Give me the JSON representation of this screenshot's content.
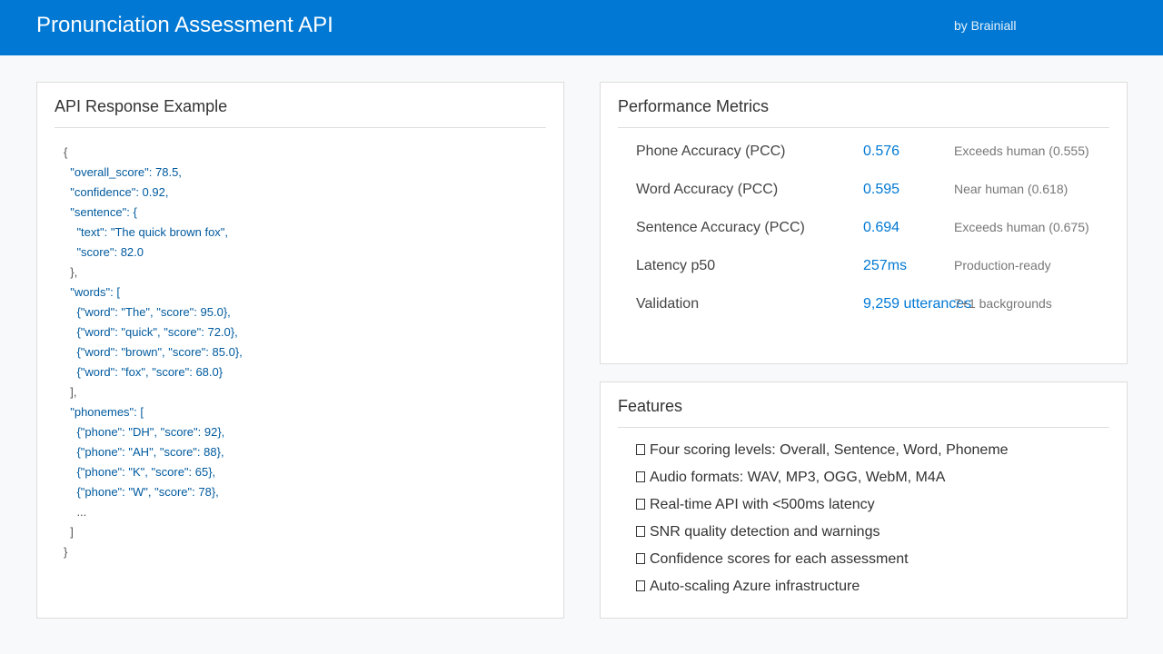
{
  "header": {
    "title": "Pronunciation Assessment API",
    "byline": "by Brainiall",
    "color": "#0078d4"
  },
  "api_example": {
    "title": "API Response Example",
    "lines": [
      "{",
      "  \"overall_score\": 78.5,",
      "  \"confidence\": 0.92,",
      "  \"sentence\": {",
      "    \"text\": \"The quick brown fox\",",
      "    \"score\": 82.0",
      "  },",
      "  \"words\": [",
      "    {\"word\": \"The\", \"score\": 95.0},",
      "    {\"word\": \"quick\", \"score\": 72.0},",
      "    {\"word\": \"brown\", \"score\": 85.0},",
      "    {\"word\": \"fox\", \"score\": 68.0}",
      "  ],",
      "  \"phonemes\": [",
      "    {\"phone\": \"DH\", \"score\": 92},",
      "    {\"phone\": \"AH\", \"score\": 88},",
      "    {\"phone\": \"K\", \"score\": 65},",
      "    {\"phone\": \"W\", \"score\": 78},",
      "    ...",
      "  ]",
      "}"
    ]
  },
  "metrics": {
    "title": "Performance Metrics",
    "rows": [
      {
        "label": "Phone Accuracy (PCC)",
        "value": "0.576",
        "note": "Exceeds human (0.555)"
      },
      {
        "label": "Word Accuracy (PCC)",
        "value": "0.595",
        "note": "Near human (0.618)"
      },
      {
        "label": "Sentence Accuracy (PCC)",
        "value": "0.694",
        "note": "Exceeds human (0.675)"
      },
      {
        "label": "Latency p50",
        "value": "257ms",
        "note": "Production-ready"
      },
      {
        "label": "Validation",
        "value": "9,259 utterances",
        "note": "7+1 backgrounds"
      }
    ]
  },
  "features": {
    "title": "Features",
    "items": [
      "Four scoring levels: Overall, Sentence, Word, Phoneme",
      "Audio formats: WAV, MP3, OGG, WebM, M4A",
      "Real-time API with <500ms latency",
      "SNR quality detection and warnings",
      "Confidence scores for each assessment",
      "Auto-scaling Azure infrastructure"
    ],
    "icon": "checkbox-icon"
  }
}
